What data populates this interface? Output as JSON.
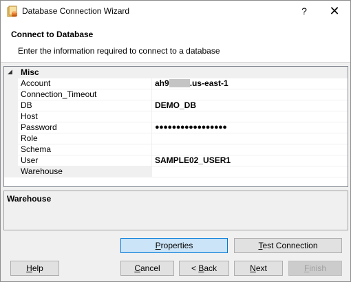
{
  "window": {
    "title": "Database Connection Wizard",
    "help_glyph": "?",
    "close_glyph": "✕",
    "icon": "database-wizard-icon"
  },
  "header": {
    "title": "Connect to Database",
    "subtitle": "Enter the information required to connect to a database"
  },
  "property_grid": {
    "category": "Misc",
    "collapse_glyph": "◢",
    "rows": [
      {
        "name": "Account",
        "value_prefix": "ah9",
        "value_suffix": ".us-east-1",
        "redacted": true
      },
      {
        "name": "Connection_Timeout",
        "value": ""
      },
      {
        "name": "DB",
        "value": "DEMO_DB"
      },
      {
        "name": "Host",
        "value": ""
      },
      {
        "name": "Password",
        "value": "●●●●●●●●●●●●●●●●●"
      },
      {
        "name": "Role",
        "value": ""
      },
      {
        "name": "Schema",
        "value": ""
      },
      {
        "name": "User",
        "value": "SAMPLE02_USER1"
      },
      {
        "name": "Warehouse",
        "value": ""
      }
    ],
    "selected": "Warehouse"
  },
  "description": {
    "title": "Warehouse"
  },
  "buttons": {
    "properties": {
      "pre": "",
      "key": "P",
      "post": "roperties"
    },
    "test_connection": {
      "pre": "",
      "key": "T",
      "post": "est Connection"
    },
    "help": {
      "pre": "",
      "key": "H",
      "post": "elp"
    },
    "cancel": {
      "pre": "",
      "key": "C",
      "post": "ancel"
    },
    "back": {
      "pre": "< ",
      "key": "B",
      "post": "ack"
    },
    "next": {
      "pre": "",
      "key": "N",
      "post": "ext"
    },
    "finish": {
      "pre": "",
      "key": "F",
      "post": "inish"
    }
  },
  "colors": {
    "accent": "#0078d7",
    "focused_button_bg": "#cce4f7",
    "window_bg": "#f0f0f0"
  }
}
